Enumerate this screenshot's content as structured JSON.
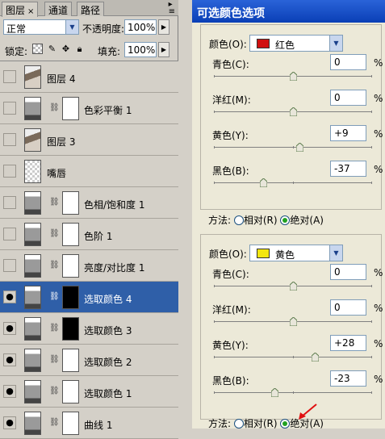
{
  "layers_panel": {
    "tabs": [
      {
        "label": "图层",
        "close": "×"
      },
      {
        "label": "通道"
      },
      {
        "label": "路径"
      }
    ],
    "blend_mode": "正常",
    "opacity_label": "不透明度:",
    "opacity_value": "100%",
    "lock_label": "锁定:",
    "fill_label": "填充:",
    "fill_value": "100%",
    "layers": [
      {
        "name": "图层 4",
        "visible": false,
        "type": "image",
        "selected": false
      },
      {
        "name": "色彩平衡 1",
        "visible": false,
        "type": "adjustment",
        "selected": false
      },
      {
        "name": "图层 3",
        "visible": false,
        "type": "image",
        "selected": false
      },
      {
        "name": "嘴唇",
        "visible": false,
        "type": "empty",
        "selected": false
      },
      {
        "name": "色相/饱和度 1",
        "visible": false,
        "type": "adjustment",
        "selected": false
      },
      {
        "name": "色阶 1",
        "visible": false,
        "type": "adjustment",
        "selected": false
      },
      {
        "name": "亮度/对比度 1",
        "visible": false,
        "type": "adjustment",
        "selected": false
      },
      {
        "name": "选取颜色 4",
        "visible": true,
        "type": "adjustment",
        "selected": true
      },
      {
        "name": "选取颜色 3",
        "visible": true,
        "type": "adjustment",
        "selected": false
      },
      {
        "name": "选取颜色 2",
        "visible": true,
        "type": "adjustment",
        "selected": false
      },
      {
        "name": "选取颜色 1",
        "visible": true,
        "type": "adjustment",
        "selected": false
      },
      {
        "name": "曲线 1",
        "visible": true,
        "type": "adjustment",
        "selected": false
      }
    ]
  },
  "dialog": {
    "title": "可选颜色选项",
    "color_label": "颜色(O):",
    "groups": [
      {
        "color_name": "红色",
        "swatch": "#d01010",
        "channels": [
          {
            "label": "青色(C):",
            "value": "0",
            "unit": "%",
            "level": 0
          },
          {
            "label": "洋红(M):",
            "value": "0",
            "unit": "%",
            "level": 0
          },
          {
            "label": "黄色(Y):",
            "value": "+9",
            "unit": "%",
            "level": 9
          },
          {
            "label": "黑色(B):",
            "value": "-37",
            "unit": "%",
            "level": -37
          }
        ]
      },
      {
        "color_name": "黄色",
        "swatch": "#f3e60f",
        "channels": [
          {
            "label": "青色(C):",
            "value": "0",
            "unit": "%",
            "level": 0
          },
          {
            "label": "洋红(M):",
            "value": "0",
            "unit": "%",
            "level": 0
          },
          {
            "label": "黄色(Y):",
            "value": "+28",
            "unit": "%",
            "level": 28
          },
          {
            "label": "黑色(B):",
            "value": "-23",
            "unit": "%",
            "level": -23
          }
        ]
      }
    ],
    "methods": [
      {
        "label": "方法:",
        "options": [
          {
            "text": "相对(R)",
            "checked": false
          },
          {
            "text": "绝对(A)",
            "checked": true
          }
        ]
      },
      {
        "label": "方法:",
        "options": [
          {
            "text": "相对(R)",
            "checked": false
          },
          {
            "text": "绝对(A)",
            "checked": true
          }
        ]
      }
    ]
  },
  "colors": {
    "selection": "#2f5fa8",
    "title_bar": "#0a3fb6",
    "radio_dot": "#21a121",
    "annotation_arrow": "#e01010"
  }
}
